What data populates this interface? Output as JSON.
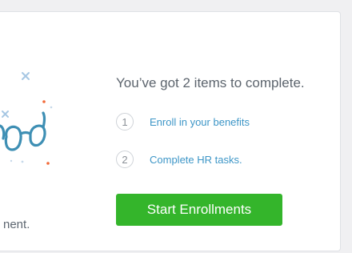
{
  "onboarding": {
    "headline": "You’ve got 2 items to complete.",
    "truncated_description": "nent.",
    "steps": [
      {
        "number": "1",
        "label": "Enroll in your benefits"
      },
      {
        "number": "2",
        "label": "Complete HR tasks."
      }
    ],
    "cta_label": "Start Enrollments"
  },
  "colors": {
    "page_background": "#f0f0f2",
    "card_background": "#ffffff",
    "link_blue": "#3d96c7",
    "button_green": "#34b52b",
    "illustration_teal": "#3e8fb4",
    "sparkle_orange": "#f26b3a"
  },
  "icons": [
    "glasses-illustration",
    "sparkle-icon"
  ]
}
